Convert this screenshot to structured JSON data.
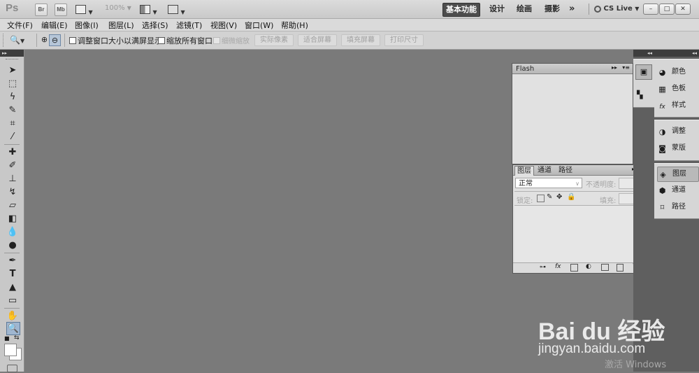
{
  "app": {
    "logo": "Ps"
  },
  "titlebar": {
    "br_label": "Br",
    "mb_label": "Mb",
    "zoom": "100%",
    "workspaces": [
      "基本功能",
      "设计",
      "绘画",
      "摄影"
    ],
    "more": "»",
    "cs_live": "CS Live",
    "win_min": "–",
    "win_max": "□",
    "win_close": "✕"
  },
  "menu": [
    "文件(F)",
    "编辑(E)",
    "图像(I)",
    "图层(L)",
    "选择(S)",
    "滤镜(T)",
    "视图(V)",
    "窗口(W)",
    "帮助(H)"
  ],
  "options": {
    "resize_window": "调整窗口大小以满屏显示",
    "zoom_all": "缩放所有窗口",
    "scrubby_zoom": "细微缩放",
    "actual_pixels": "实际像素",
    "fit_screen": "适合屏幕",
    "fill_screen": "填充屏幕",
    "print_size": "打印尺寸"
  },
  "flash_panel": {
    "title": "Flash"
  },
  "layers_panel": {
    "tabs": [
      "图层",
      "通道",
      "路径"
    ],
    "blend_mode": "正常",
    "opacity_label": "不透明度:",
    "lock_label": "锁定:",
    "fill_label": "填充:"
  },
  "dock": {
    "group1": [
      "颜色",
      "色板",
      "样式"
    ],
    "group2": [
      "调整",
      "蒙版"
    ],
    "group3": [
      "图层",
      "通道",
      "路径"
    ]
  },
  "watermark": {
    "logo": "Bai du 经验",
    "url": "jingyan.baidu.com",
    "activate": "激活 Windows"
  }
}
